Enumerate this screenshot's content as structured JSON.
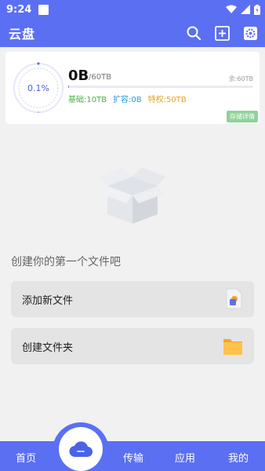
{
  "status_bar": {
    "time": "9:24"
  },
  "app_bar": {
    "title": "云盘"
  },
  "storage": {
    "percent_label": "0.1%",
    "used": "0B",
    "total": "/60TB",
    "remaining": "余:60TB",
    "usage_fraction": 0.001,
    "base": "基础:10TB",
    "expansion": "扩容:0B",
    "privilege": "特权:50TB",
    "details_label": "存储详情"
  },
  "empty_state": {
    "hint": "创建你的第一个文件吧"
  },
  "actions": [
    {
      "label": "添加新文件",
      "icon": "add-file-icon"
    },
    {
      "label": "创建文件夹",
      "icon": "folder-icon"
    }
  ],
  "bottom_nav": {
    "home": "首页",
    "transfer": "传输",
    "apps": "应用",
    "mine": "我的"
  },
  "colors": {
    "primary": "#5b6ff3",
    "base_green": "#4ab04a",
    "expansion_blue": "#2a9bd1",
    "privilege_orange": "#e4a620",
    "folder_yellow": "#ffc24a"
  }
}
